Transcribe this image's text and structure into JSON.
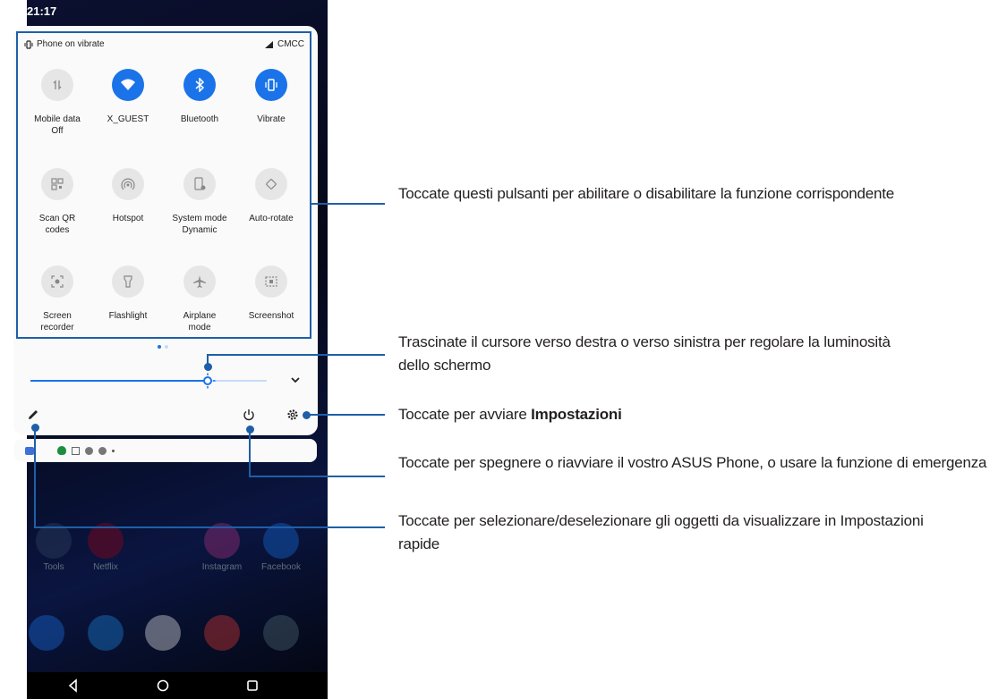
{
  "status_bar": {
    "time": "21:17"
  },
  "shade_header": {
    "vibrate_status": "Phone on vibrate",
    "carrier": "CMCC"
  },
  "tiles": [
    {
      "label": "Mobile data\nOff",
      "icon": "mobile-data-icon",
      "active": false
    },
    {
      "label": "X_GUEST",
      "icon": "wifi-icon",
      "active": true
    },
    {
      "label": "Bluetooth",
      "icon": "bluetooth-icon",
      "active": true
    },
    {
      "label": "Vibrate",
      "icon": "vibrate-icon",
      "active": true
    },
    {
      "label": "Scan QR\ncodes",
      "icon": "qr-code-icon",
      "active": false
    },
    {
      "label": "Hotspot",
      "icon": "hotspot-icon",
      "active": false
    },
    {
      "label": "System mode\nDynamic",
      "icon": "system-mode-icon",
      "active": false
    },
    {
      "label": "Auto-rotate",
      "icon": "auto-rotate-icon",
      "active": false
    },
    {
      "label": "Screen\nrecorder",
      "icon": "screen-recorder-icon",
      "active": false
    },
    {
      "label": "Flashlight",
      "icon": "flashlight-icon",
      "active": false
    },
    {
      "label": "Airplane\nmode",
      "icon": "airplane-icon",
      "active": false
    },
    {
      "label": "Screenshot",
      "icon": "screenshot-icon",
      "active": false
    }
  ],
  "brightness": {
    "level": 0.75,
    "accent": "#1a73e8"
  },
  "home_apps": [
    {
      "label": "Tools",
      "color": "#3a4a6a"
    },
    {
      "label": "Netflix",
      "color": "#b00010"
    },
    {
      "label": "Instagram",
      "color": "#c13584"
    },
    {
      "label": "Facebook",
      "color": "#1877f2"
    }
  ],
  "callouts": {
    "tiles": "Toccate questi pulsanti per abilitare o disabilitare la funzione corrispondente",
    "brightness": "Trascinate il cursore verso destra o verso sinistra per regolare la luminosità dello schermo",
    "settings_prefix": "Toccate per avviare ",
    "settings_bold": "Impostazioni",
    "power": "Toccate per spegnere o riavviare il vostro ASUS Phone, o usare la funzione di emergenza",
    "edit": "Toccate per selezionare/deselezionare gli oggetti da visualizzare in Impostazioni rapide"
  },
  "colors": {
    "callout": "#1f5fa8",
    "active_tile": "#1a73e8",
    "inactive_tile": "#e6e6e6"
  }
}
